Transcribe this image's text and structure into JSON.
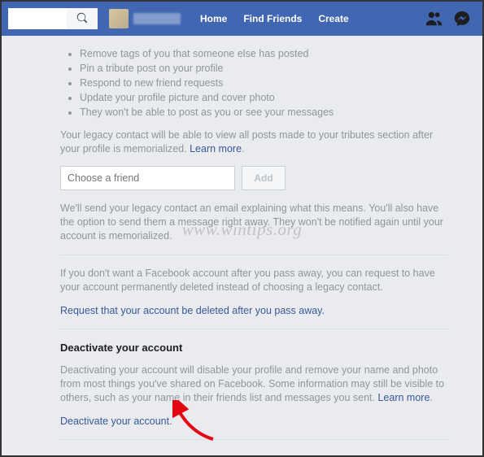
{
  "nav": {
    "home": "Home",
    "find_friends": "Find Friends",
    "create": "Create"
  },
  "bullets": [
    "Remove tags of you that someone else has posted",
    "Pin a tribute post on your profile",
    "Respond to new friend requests",
    "Update your profile picture and cover photo",
    "They won't be able to post as you or see your messages"
  ],
  "legacy_para": "Your legacy contact will be able to view all posts made to your tributes section after your profile is memorialized. ",
  "learn_more": "Learn more",
  "friend_placeholder": "Choose a friend",
  "add_label": "Add",
  "email_para": "We'll send your legacy contact an email explaining what this means. You'll also have the option to send them a message right away. They won't be notified again until your account is memorialized.",
  "delete_para": "If you don't want a Facebook account after you pass away, you can request to have your account permanently deleted instead of choosing a legacy contact.",
  "request_delete_link": "Request that your account be deleted after you pass away.",
  "deactivate_title": "Deactivate your account",
  "deactivate_para": "Deactivating your account will disable your profile and remove your name and photo from most things you've shared on Facebook. Some information may still be visible to others, such as your name in their friends list and messages you sent. ",
  "deactivate_link": "Deactivate your account.",
  "watermark": "www.wintips.org"
}
